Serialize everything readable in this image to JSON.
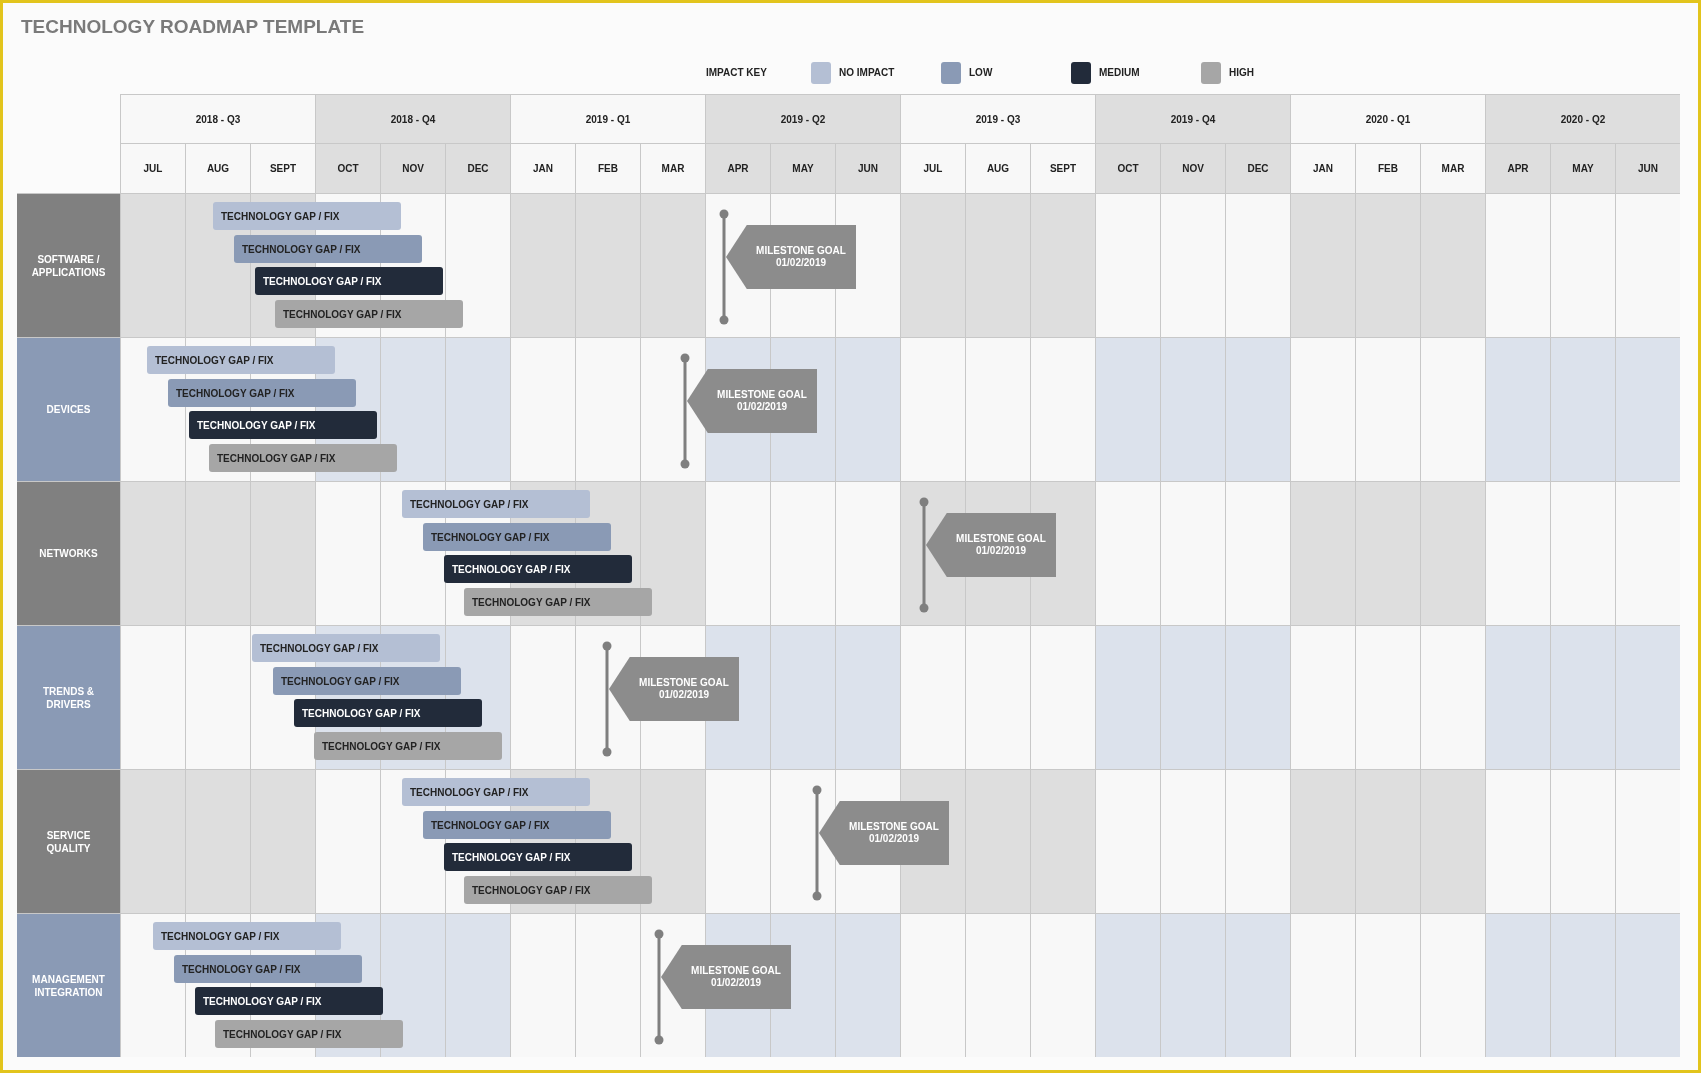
{
  "title": "TECHNOLOGY ROADMAP TEMPLATE",
  "impact_key": {
    "label": "IMPACT KEY",
    "items": [
      {
        "label": "NO IMPACT",
        "color": "#b4bfd4"
      },
      {
        "label": "LOW",
        "color": "#8a9ab5"
      },
      {
        "label": "MEDIUM",
        "color": "#222b3a"
      },
      {
        "label": "HIGH",
        "color": "#a6a6a6"
      }
    ]
  },
  "quarters": [
    "2018 - Q3",
    "2018 - Q4",
    "2019 - Q1",
    "2019 - Q2",
    "2019 - Q3",
    "2019 - Q4",
    "2020 - Q1",
    "2020 - Q2"
  ],
  "months": [
    "JUL",
    "AUG",
    "SEPT",
    "OCT",
    "NOV",
    "DEC",
    "JAN",
    "FEB",
    "MAR",
    "APR",
    "MAY",
    "JUN",
    "JUL",
    "AUG",
    "SEPT",
    "OCT",
    "NOV",
    "DEC",
    "JAN",
    "FEB",
    "MAR",
    "APR",
    "MAY",
    "JUN"
  ],
  "categories": [
    {
      "label": "SOFTWARE / APPLICATIONS",
      "color": "#808080",
      "bars": [
        {
          "label": "TECHNOLOGY GAP / FIX",
          "color": "#b4bfd4"
        },
        {
          "label": "TECHNOLOGY GAP / FIX",
          "color": "#8a9ab5"
        },
        {
          "label": "TECHNOLOGY GAP / FIX",
          "color": "#222b3a"
        },
        {
          "label": "TECHNOLOGY GAP / FIX",
          "color": "#a6a6a6"
        }
      ],
      "milestone": {
        "label": "MILESTONE GOAL",
        "date": "01/02/2019"
      }
    },
    {
      "label": "DEVICES",
      "color": "#8a9ab5",
      "bars": [
        {
          "label": "TECHNOLOGY GAP / FIX",
          "color": "#b4bfd4"
        },
        {
          "label": "TECHNOLOGY GAP / FIX",
          "color": "#8a9ab5"
        },
        {
          "label": "TECHNOLOGY GAP / FIX",
          "color": "#222b3a"
        },
        {
          "label": "TECHNOLOGY GAP / FIX",
          "color": "#a6a6a6"
        }
      ],
      "milestone": {
        "label": "MILESTONE GOAL",
        "date": "01/02/2019"
      }
    },
    {
      "label": "NETWORKS",
      "color": "#808080",
      "bars": [
        {
          "label": "TECHNOLOGY GAP / FIX",
          "color": "#b4bfd4"
        },
        {
          "label": "TECHNOLOGY GAP / FIX",
          "color": "#8a9ab5"
        },
        {
          "label": "TECHNOLOGY GAP / FIX",
          "color": "#222b3a"
        },
        {
          "label": "TECHNOLOGY GAP / FIX",
          "color": "#a6a6a6"
        }
      ],
      "milestone": {
        "label": "MILESTONE GOAL",
        "date": "01/02/2019"
      }
    },
    {
      "label": "TRENDS & DRIVERS",
      "color": "#8a9ab5",
      "bars": [
        {
          "label": "TECHNOLOGY GAP / FIX",
          "color": "#b4bfd4"
        },
        {
          "label": "TECHNOLOGY GAP / FIX",
          "color": "#8a9ab5"
        },
        {
          "label": "TECHNOLOGY GAP / FIX",
          "color": "#222b3a"
        },
        {
          "label": "TECHNOLOGY GAP / FIX",
          "color": "#a6a6a6"
        }
      ],
      "milestone": {
        "label": "MILESTONE GOAL",
        "date": "01/02/2019"
      }
    },
    {
      "label": "SERVICE QUALITY",
      "color": "#808080",
      "bars": [
        {
          "label": "TECHNOLOGY GAP / FIX",
          "color": "#b4bfd4"
        },
        {
          "label": "TECHNOLOGY GAP / FIX",
          "color": "#8a9ab5"
        },
        {
          "label": "TECHNOLOGY GAP / FIX",
          "color": "#222b3a"
        },
        {
          "label": "TECHNOLOGY GAP / FIX",
          "color": "#a6a6a6"
        }
      ],
      "milestone": {
        "label": "MILESTONE GOAL",
        "date": "01/02/2019"
      }
    },
    {
      "label": "MANAGEMENT INTEGRATION",
      "color": "#8a9ab5",
      "bars": [
        {
          "label": "TECHNOLOGY GAP / FIX",
          "color": "#b4bfd4"
        },
        {
          "label": "TECHNOLOGY GAP / FIX",
          "color": "#8a9ab5"
        },
        {
          "label": "TECHNOLOGY GAP / FIX",
          "color": "#222b3a"
        },
        {
          "label": "TECHNOLOGY GAP / FIX",
          "color": "#a6a6a6"
        }
      ],
      "milestone": {
        "label": "MILESTONE GOAL",
        "date": "01/02/2019"
      }
    }
  ]
}
